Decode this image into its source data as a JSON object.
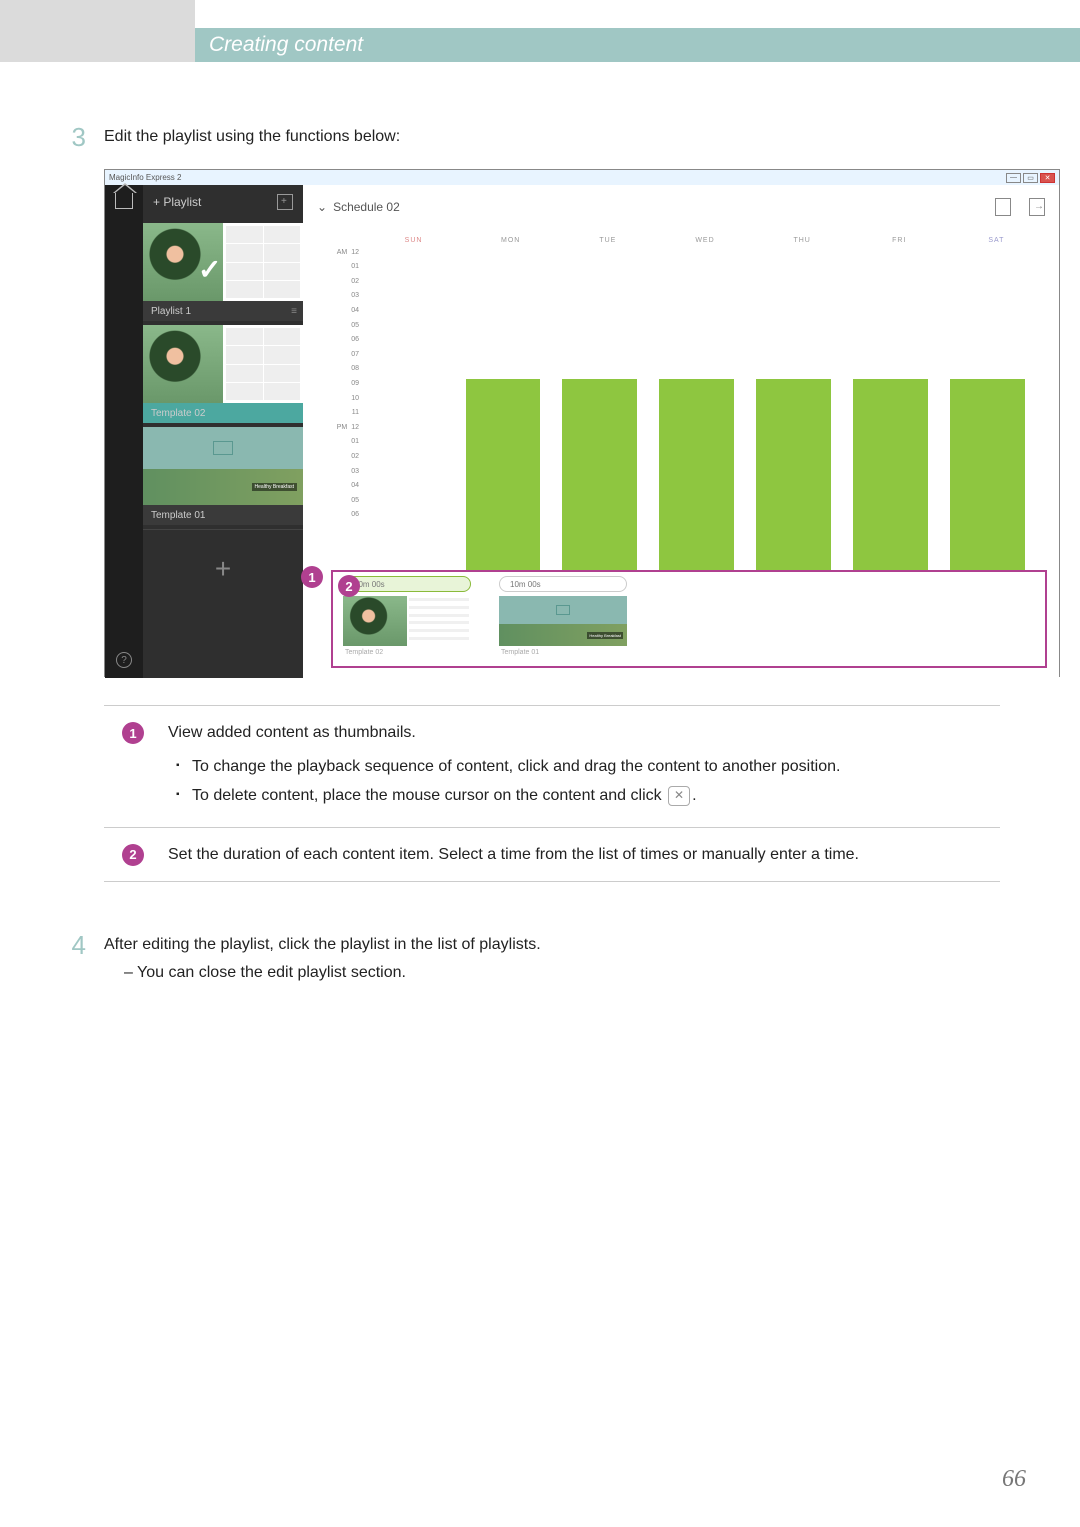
{
  "header": {
    "title": "Creating content"
  },
  "step3": {
    "num": "3",
    "text": "Edit the playlist using the functions below:"
  },
  "app": {
    "window_title": "MagicInfo Express 2",
    "sidebar": {
      "add_playlist": "+ Playlist",
      "items": [
        {
          "label": "Playlist 1",
          "selected": true
        },
        {
          "label": "Template 02",
          "highlighted": true
        },
        {
          "label": "Template 01"
        }
      ],
      "add": "+"
    },
    "schedule": {
      "title": "Schedule 02",
      "days": [
        "SUN",
        "MON",
        "TUE",
        "WED",
        "THU",
        "FRI",
        "SAT"
      ],
      "hours_am": [
        "12",
        "01",
        "02",
        "03",
        "04",
        "05",
        "06",
        "07",
        "08",
        "09",
        "10",
        "11"
      ],
      "hours_pm": [
        "12",
        "01",
        "02",
        "03",
        "04",
        "05",
        "06"
      ],
      "am": "AM",
      "pm": "PM"
    },
    "editor": {
      "items": [
        {
          "duration": "10m 00s",
          "label": "Template 02",
          "active": true
        },
        {
          "duration": "10m 00s",
          "label": "Template 01",
          "active": false
        }
      ]
    },
    "overlay": {
      "thumb_badge": "Healthy Breakfast"
    }
  },
  "callouts": {
    "c1": "1",
    "c2": "2"
  },
  "legend": {
    "r1": {
      "badge": "1",
      "intro": "View added content as thumbnails.",
      "b1": "To change the playback sequence of content, click and drag the content to another position.",
      "b2a": "To delete content, place the mouse cursor on the content and click ",
      "b2b": "."
    },
    "r2": {
      "badge": "2",
      "text": "Set the duration of each content item. Select a time from the list of times or manually enter a time."
    }
  },
  "step4": {
    "num": "4",
    "text": "After editing the playlist, click the playlist in the list of playlists.",
    "sub": "– You can close the edit playlist section."
  },
  "page": "66"
}
